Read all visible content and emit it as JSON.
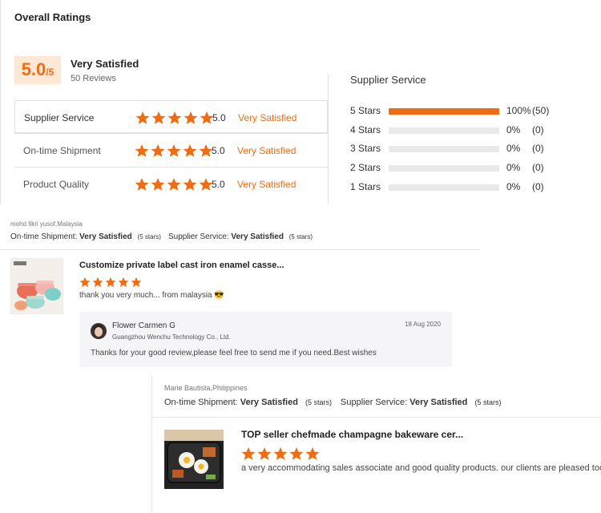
{
  "overall": {
    "title": "Overall Ratings",
    "score": "5.0",
    "score_suffix": "/5",
    "summary": "Very Satisfied",
    "reviews_count": "50 Reviews",
    "rows": [
      {
        "label": "Supplier Service",
        "score": "5.0",
        "text": "Very Satisfied",
        "stars": 5
      },
      {
        "label": "On-time Shipment",
        "score": "5.0",
        "text": "Very Satisfied",
        "stars": 5
      },
      {
        "label": "Product Quality",
        "score": "5.0",
        "text": "Very Satisfied",
        "stars": 5
      }
    ]
  },
  "breakdown": {
    "title": "Supplier Service",
    "rows": [
      {
        "label": "5 Stars",
        "percent": "100%",
        "count": "(50)",
        "fill": 1.0
      },
      {
        "label": "4 Stars",
        "percent": "0%",
        "count": "(0)",
        "fill": 0
      },
      {
        "label": "3 Stars",
        "percent": "0%",
        "count": "(0)",
        "fill": 0
      },
      {
        "label": "2 Stars",
        "percent": "0%",
        "count": "(0)",
        "fill": 0
      },
      {
        "label": "1 Stars",
        "percent": "0%",
        "count": "(0)",
        "fill": 0
      }
    ]
  },
  "reviews": [
    {
      "reviewer": "mohd fikri yusof,Malaysia",
      "shipment_label": "On-time Shipment:",
      "shipment_value": "Very Satisfied",
      "shipment_stars": "(5 stars)",
      "service_label": "Supplier Service:",
      "service_value": "Very Satisfied",
      "service_stars": "(5 stars)",
      "product_title": "Customize private label cast iron enamel casse...",
      "rating": 5,
      "comment": "thank you very much... from malaysia 😎",
      "reply": {
        "name": "Flower Carmen G",
        "company": "Guangzhou Wenchu Technology Co., Ltd.",
        "date": "18 Aug 2020",
        "text": "Thanks for your good review,please feel free to send me if you need.Best wishes"
      }
    },
    {
      "reviewer": "Marie Bautista,Philippines",
      "shipment_label": "On-time Shipment:",
      "shipment_value": "Very Satisfied",
      "shipment_stars": "(5 stars)",
      "service_label": "Supplier Service:",
      "service_value": "Very Satisfied",
      "service_stars": "(5 stars)",
      "product_title": "TOP seller chefmade champagne bakeware cer...",
      "rating": 5,
      "comment": "a very accommodating sales associate and good quality products. our clients are pleased too."
    }
  ],
  "colors": {
    "accent": "#f06c12",
    "score_bg": "#fde8d6",
    "bar_track": "#e9e9ec",
    "reply_bg": "#f5f5f7"
  }
}
